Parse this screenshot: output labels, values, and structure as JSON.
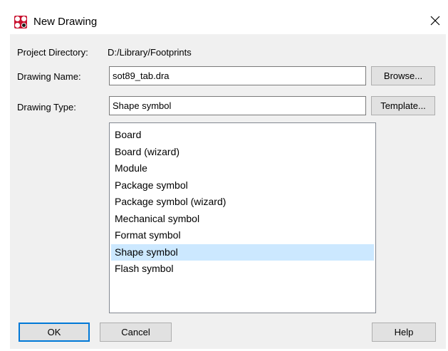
{
  "window": {
    "title": "New Drawing",
    "app_icon": "allegro-app-icon",
    "close_icon": "close-icon"
  },
  "form": {
    "project_directory_label": "Project Directory:",
    "project_directory_value": "D:/Library/Footprints",
    "drawing_name_label": "Drawing Name:",
    "drawing_name_value": "sot89_tab.dra",
    "browse_label": "Browse...",
    "drawing_type_label": "Drawing Type:",
    "drawing_type_value": "Shape symbol",
    "template_label": "Template..."
  },
  "drawing_types": {
    "items": [
      "Board",
      "Board (wizard)",
      "Module",
      "Package symbol",
      "Package symbol (wizard)",
      "Mechanical symbol",
      "Format symbol",
      "Shape symbol",
      "Flash symbol"
    ],
    "selected": "Shape symbol",
    "selected_color": "#cce8ff"
  },
  "buttons": {
    "ok_label": "OK",
    "cancel_label": "Cancel",
    "help_label": "Help"
  },
  "colors": {
    "dialog_background": "#f0f0f0",
    "default_button_border": "#0078d7",
    "app_icon_red": "#c8102e"
  }
}
